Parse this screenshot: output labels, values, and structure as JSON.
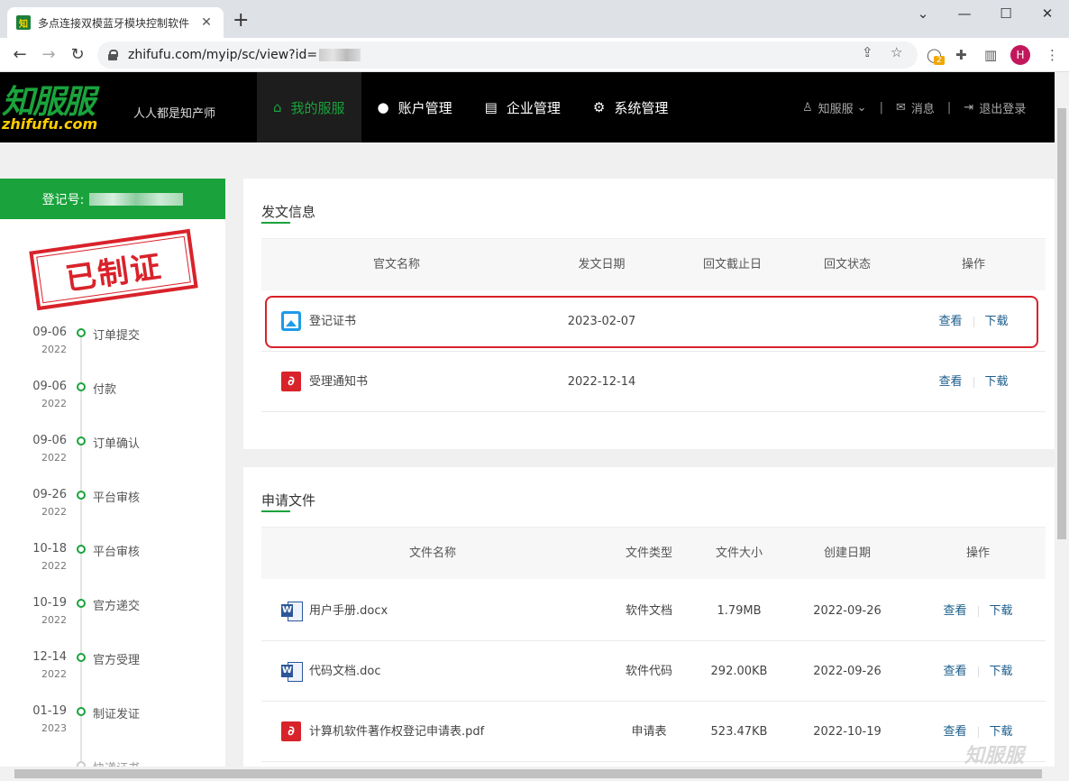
{
  "browser": {
    "tab_title": "多点连接双模蓝牙模块控制软件",
    "favicon_text": "知",
    "url": "zhifufu.com/myip/sc/view?id=",
    "extension_badge": "2",
    "profile_initial": "H"
  },
  "header": {
    "logo_cn": "知服服",
    "logo_en": "zhifufu.com",
    "slogan": "人人都是知产师",
    "nav": [
      {
        "label": "我的服服",
        "icon": "home-icon"
      },
      {
        "label": "账户管理",
        "icon": "user-icon"
      },
      {
        "label": "企业管理",
        "icon": "building-icon"
      },
      {
        "label": "系统管理",
        "icon": "gear-icon"
      }
    ],
    "user_label": "知服服",
    "messages_label": "消息",
    "logout_label": "退出登录"
  },
  "sidebar": {
    "reg_label": "登记号:",
    "stamp": "已制证",
    "timeline": [
      {
        "date": "09-06",
        "year": "2022",
        "label": "订单提交"
      },
      {
        "date": "09-06",
        "year": "2022",
        "label": "付款"
      },
      {
        "date": "09-06",
        "year": "2022",
        "label": "订单确认"
      },
      {
        "date": "09-26",
        "year": "2022",
        "label": "平台审核"
      },
      {
        "date": "10-18",
        "year": "2022",
        "label": "平台审核"
      },
      {
        "date": "10-19",
        "year": "2022",
        "label": "官方递交"
      },
      {
        "date": "12-14",
        "year": "2022",
        "label": "官方受理"
      },
      {
        "date": "01-19",
        "year": "2023",
        "label": "制证发证"
      },
      {
        "date": "",
        "year": "",
        "label": "快递证书"
      }
    ]
  },
  "dispatch": {
    "title": "发文信息",
    "headers": [
      "官文名称",
      "发文日期",
      "回文截止日",
      "回文状态",
      "操作"
    ],
    "rows": [
      {
        "name": "登记证书",
        "date": "2023-02-07",
        "deadline": "",
        "status": "",
        "view": "查看",
        "download": "下载",
        "icon": "image-file-icon"
      },
      {
        "name": "受理通知书",
        "date": "2022-12-14",
        "deadline": "",
        "status": "",
        "view": "查看",
        "download": "下载",
        "icon": "pdf-file-icon"
      }
    ]
  },
  "files": {
    "title": "申请文件",
    "headers": [
      "文件名称",
      "文件类型",
      "文件大小",
      "创建日期",
      "操作"
    ],
    "rows": [
      {
        "name": "用户手册.docx",
        "type": "软件文档",
        "size": "1.79MB",
        "date": "2022-09-26",
        "view": "查看",
        "download": "下载",
        "icon": "word-file-icon"
      },
      {
        "name": "代码文档.doc",
        "type": "软件代码",
        "size": "292.00KB",
        "date": "2022-09-26",
        "view": "查看",
        "download": "下载",
        "icon": "word-file-icon"
      },
      {
        "name": "计算机软件著作权登记申请表.pdf",
        "type": "申请表",
        "size": "523.47KB",
        "date": "2022-10-19",
        "view": "查看",
        "download": "下载",
        "icon": "pdf-file-icon"
      }
    ]
  },
  "watermark": "知服服",
  "colors": {
    "brand": "#1aa33c",
    "highlight": "#d9222a",
    "link": "#1a5c8a"
  }
}
